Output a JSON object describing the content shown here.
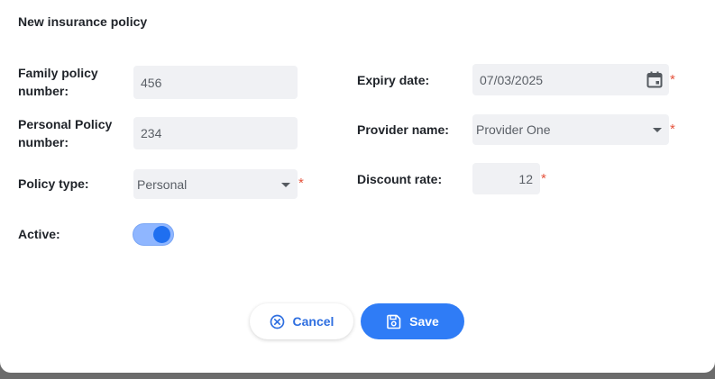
{
  "dialog": {
    "title": "New insurance policy"
  },
  "form": {
    "family_policy": {
      "label_line1": "Family policy",
      "label_line2": "number:",
      "value": "456"
    },
    "personal_policy": {
      "label_line1": "Personal Policy",
      "label_line2": "number:",
      "value": "234"
    },
    "policy_type": {
      "label": "Policy type:",
      "value": "Personal",
      "required_mark": "*"
    },
    "active": {
      "label": "Active:",
      "checked": true
    },
    "expiry_date": {
      "label": "Expiry date:",
      "value": "07/03/2025",
      "required_mark": "*"
    },
    "provider_name": {
      "label": "Provider name:",
      "value": "Provider One",
      "required_mark": "*"
    },
    "discount_rate": {
      "label": "Discount rate:",
      "value": "12",
      "required_mark": "*"
    }
  },
  "actions": {
    "cancel_label": "Cancel",
    "save_label": "Save"
  },
  "icons": {
    "calendar": "calendar-icon",
    "cancel": "close-circle-icon",
    "save": "floppy-disk-icon"
  },
  "colors": {
    "primary": "#2f7cf6",
    "required": "#e5533d",
    "field_bg": "#f0f1f4",
    "toggle_track": "#8fb6ff",
    "toggle_knob": "#1f6ff0"
  }
}
